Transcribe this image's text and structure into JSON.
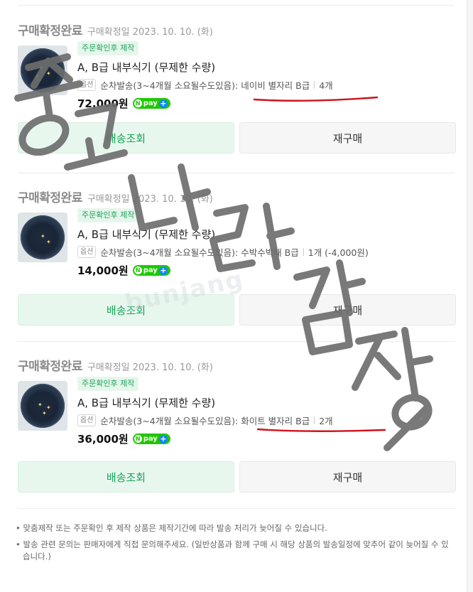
{
  "orders": [
    {
      "status": "구매확정완료",
      "confirm_date": "구매확정일 2023. 10. 10. (화)",
      "badge": "주문확인후 제작",
      "product_name": "A, B급 내부식기 (무제한 수량)",
      "option_chip": "옵션",
      "option_text": "순차발송(3~4개월 소요될수도있음): 네이비 별자리 B급",
      "option_qty": "4개",
      "price": "72,000원",
      "track_button": "배송조회",
      "rebuy_button": "재구매"
    },
    {
      "status": "구매확정완료",
      "confirm_date": "구매확정일 2023. 10. 10. (화)",
      "badge": "주문확인후 제작",
      "product_name": "A, B급 내부식기 (무제한 수량)",
      "option_chip": "옵션",
      "option_text": "순차발송(3~4개월 소요될수도있음): 수박수박해 B급",
      "option_qty": "1개 (-4,000원)",
      "price": "14,000원",
      "track_button": "배송조회",
      "rebuy_button": "재구매"
    },
    {
      "status": "구매확정완료",
      "confirm_date": "구매확정일 2023. 10. 10. (화)",
      "badge": "주문확인후 제작",
      "product_name": "A, B급 내부식기 (무제한 수량)",
      "option_chip": "옵션",
      "option_text": "순차발송(3~4개월 소요될수도있음): 화이트 별자리 B급",
      "option_qty": "2개",
      "price": "36,000원",
      "track_button": "배송조회",
      "rebuy_button": "재구매"
    }
  ],
  "npay": {
    "label": "pay",
    "n": "N",
    "plus": "+"
  },
  "notes": [
    "• 맞춤제작 또는 주문확인 후 제작 상품은 제작기간에 따라 발송 처리가 늦어질 수 있습니다.",
    "• 발송 관련 문의는 판매자에게 직접 문의해주세요. (일반상품과 함께 구매 시 해당 상품의 발송일정에 맞추어 같이 늦어질 수 있습니다.)"
  ],
  "watermark": {
    "handwritten": "중고나라 감자9",
    "faint": "bunjang"
  },
  "colors": {
    "accent_green": "#18a455",
    "underline_red": "#d0111b",
    "watermark_gray": "#6e6e6e"
  }
}
